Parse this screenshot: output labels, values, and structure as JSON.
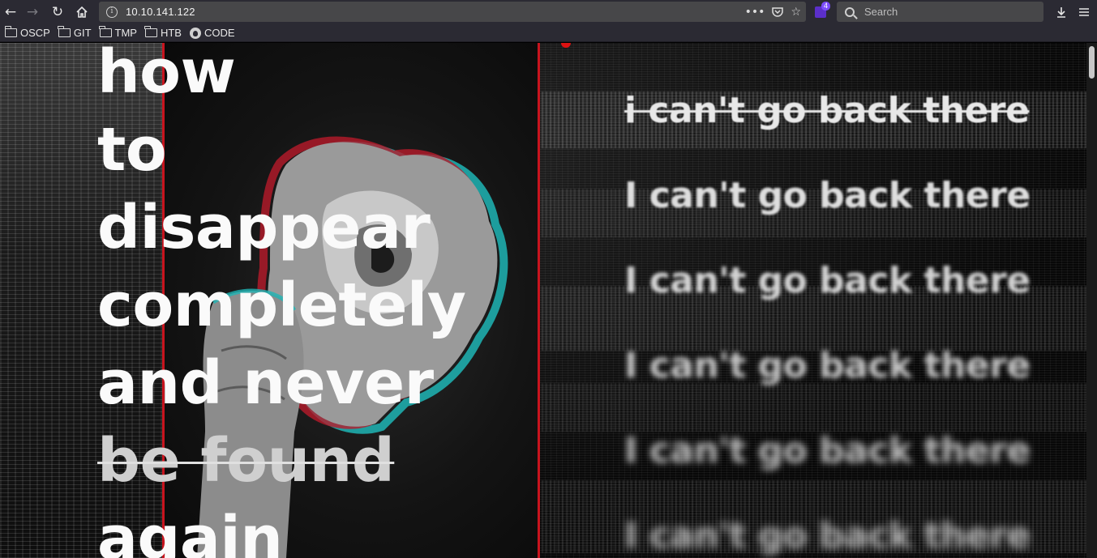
{
  "browser": {
    "url": "10.10.141.122",
    "search_placeholder": "Search",
    "extension_badge": "4",
    "icons": {
      "back": "arrow-left-icon",
      "forward": "arrow-right-icon",
      "reload": "reload-icon",
      "home": "home-icon",
      "page_actions": "ellipsis-icon",
      "pocket": "pocket-icon",
      "bookmark": "star-icon",
      "downloads": "download-icon",
      "menu": "hamburger-icon"
    }
  },
  "bookmarks": [
    {
      "label": "OSCP",
      "icon": "folder-icon"
    },
    {
      "label": "GIT",
      "icon": "folder-icon"
    },
    {
      "label": "TMP",
      "icon": "folder-icon"
    },
    {
      "label": "HTB",
      "icon": "folder-icon"
    },
    {
      "label": "CODE",
      "icon": "github-icon"
    }
  ],
  "page": {
    "headline": {
      "line1": "how",
      "line2": "to",
      "line3": "disappear",
      "line4": "completely",
      "line5": "and never",
      "line6": "be found",
      "line7": "again"
    },
    "echo_text": "i can't go back there",
    "echo_lines": [
      "i can't go back there",
      "I can't go back there",
      "I can't go back there",
      "I can't go back there",
      "I can't go back there",
      "I can't go back there"
    ],
    "colors": {
      "accent_red": "#c8141e",
      "text": "#fafafa",
      "background": "#0a0a0a"
    }
  }
}
